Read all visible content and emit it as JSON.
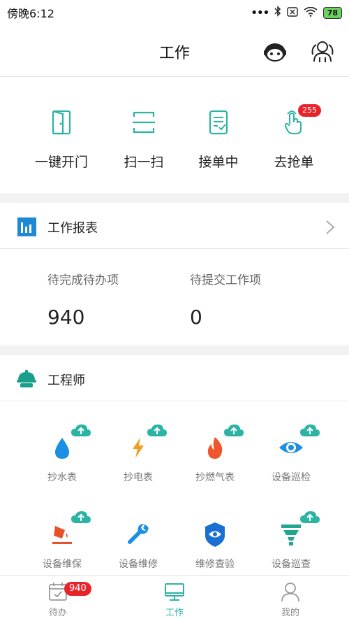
{
  "status_bar": {
    "time": "傍晚6:12",
    "battery": "78"
  },
  "header": {
    "title": "工作",
    "robot_icon": "robot-icon",
    "people_icon": "people-icon"
  },
  "quick_actions": [
    {
      "label": "一键开门",
      "icon": "door-icon"
    },
    {
      "label": "扫一扫",
      "icon": "scan-icon"
    },
    {
      "label": "接单中",
      "icon": "order-list-icon"
    },
    {
      "label": "去抢单",
      "icon": "tap-hand-icon",
      "badge": "255"
    }
  ],
  "report": {
    "title": "工作报表",
    "stats": [
      {
        "label": "待完成待办项",
        "value": "940"
      },
      {
        "label": "待提交工作项",
        "value": "0"
      }
    ]
  },
  "engineer": {
    "title": "工程师",
    "items": [
      {
        "label": "抄水表",
        "icon": "water-drop-icon",
        "color": "#1a8fe3"
      },
      {
        "label": "抄电表",
        "icon": "lightning-icon",
        "color": "#f0a020"
      },
      {
        "label": "抄燃气表",
        "icon": "flame-icon",
        "color": "#f0552b"
      },
      {
        "label": "设备巡检",
        "icon": "eye-icon",
        "color": "#1a8fe3"
      },
      {
        "label": "设备维保",
        "icon": "paint-bucket-icon",
        "color": "#e8522a"
      },
      {
        "label": "设备维修",
        "icon": "wrench-icon",
        "color": "#1a8fe3"
      },
      {
        "label": "维修查验",
        "icon": "shield-eye-icon",
        "color": "#1a6fd3"
      },
      {
        "label": "设备巡查",
        "icon": "funnel-icon",
        "color": "#22a68e"
      }
    ]
  },
  "tabbar": [
    {
      "label": "待办",
      "badge": "940"
    },
    {
      "label": "工作",
      "active": true
    },
    {
      "label": "我的"
    }
  ],
  "colors": {
    "accent": "#2bb3a3",
    "badge": "#e8242b",
    "report_icon": "#1e88d6"
  }
}
